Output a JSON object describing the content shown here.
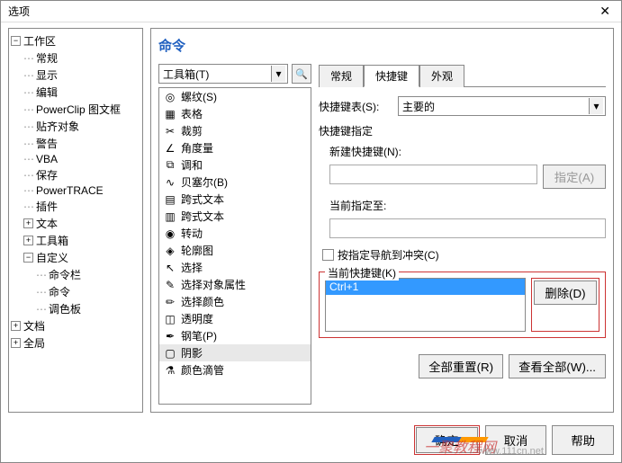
{
  "window": {
    "title": "选项"
  },
  "tree": {
    "workspace": "工作区",
    "general": "常规",
    "display": "显示",
    "edit": "编辑",
    "powerclip": "PowerClip 图文框",
    "snap": "贴齐对象",
    "warning": "警告",
    "vba": "VBA",
    "save": "保存",
    "powertrace": "PowerTRACE",
    "plugins": "插件",
    "text": "文本",
    "toolbox": "工具箱",
    "customize": "自定义",
    "cmdbar": "命令栏",
    "command": "命令",
    "palette": "调色板",
    "document": "文档",
    "global": "全局"
  },
  "panel": {
    "title": "命令"
  },
  "combo": {
    "toolbox": "工具箱(T)"
  },
  "commands": {
    "thread": "螺纹(S)",
    "table": "表格",
    "crop": "裁剪",
    "angle": "角度量",
    "harmony": "调和",
    "bezier": "贝塞尔(B)",
    "paratext": "跨式文本",
    "paratext2": "跨式文本",
    "rotate": "转动",
    "contour": "轮廓图",
    "select": "选择",
    "selectprops": "选择对象属性",
    "selectcolor": "选择颜色",
    "transparency": "透明度",
    "pen": "钢笔(P)",
    "shadow": "阴影",
    "eyedropper": "颜色滴管"
  },
  "tabs": {
    "general": "常规",
    "shortcut": "快捷键",
    "appearance": "外观"
  },
  "right": {
    "shortcut_table_label": "快捷键表(S):",
    "primary": "主要的",
    "shortcut_assign_label": "快捷键指定",
    "new_shortcut_label": "新建快捷键(N):",
    "assign_btn": "指定(A)",
    "current_assign_label": "当前指定至:",
    "checkbox_label": "按指定导航到冲突(C)",
    "current_key_label": "当前快捷键(K)",
    "current_key_value": "Ctrl+1",
    "delete_btn": "删除(D)",
    "reset_all": "全部重置(R)",
    "view_all": "查看全部(W)..."
  },
  "footer": {
    "ok": "确定",
    "cancel": "取消",
    "help": "帮助"
  },
  "watermark": {
    "text": "一聚教程网",
    "sub": "www.111cn.net"
  }
}
